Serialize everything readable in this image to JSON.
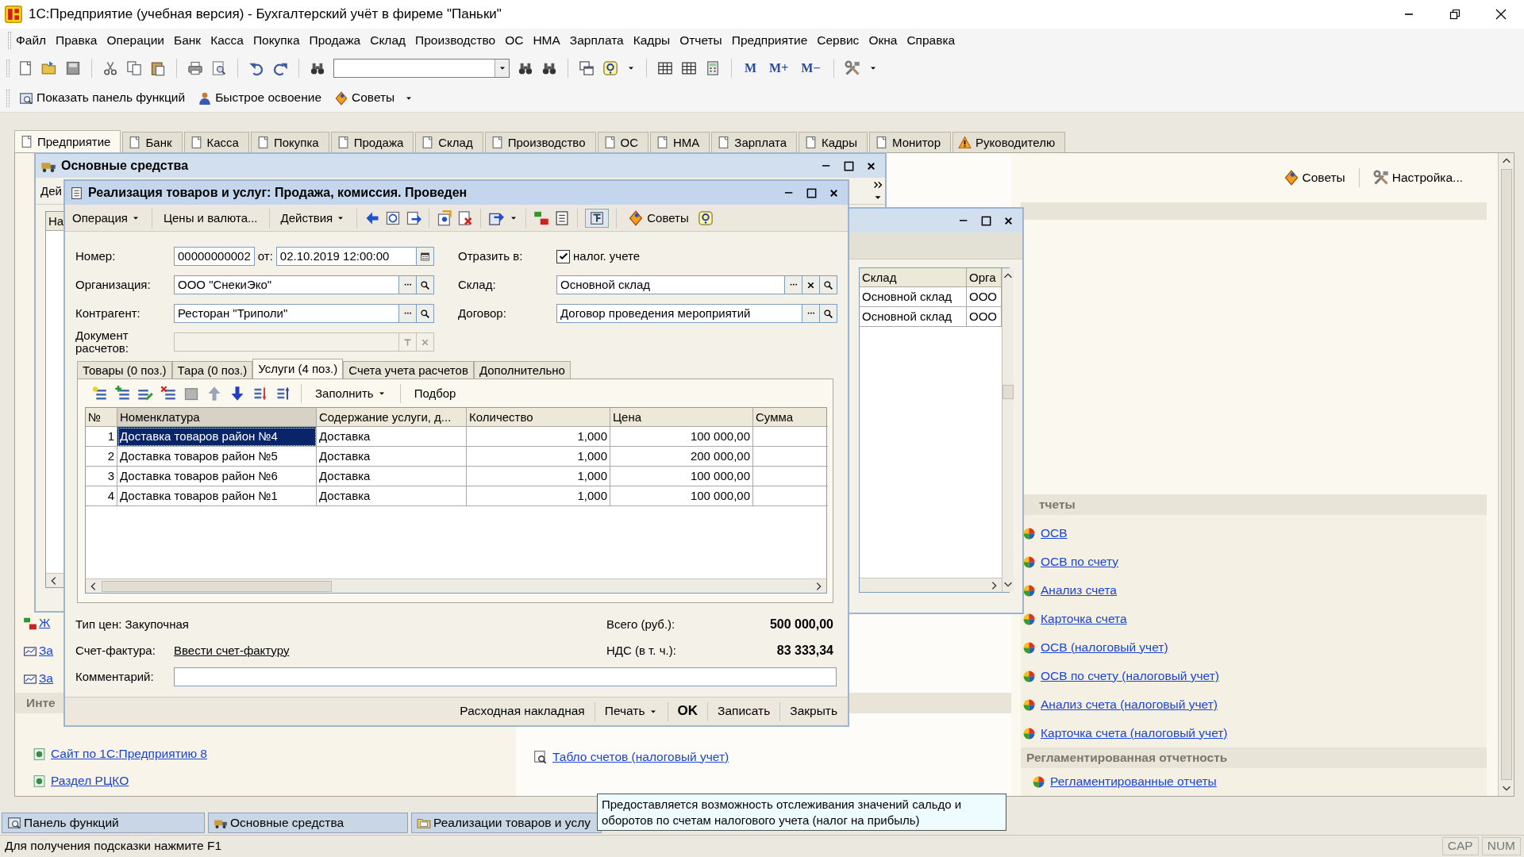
{
  "app_window": {
    "title": "1С:Предприятие (учебная версия) - Бухгалтерский учёт в фиреме \"Паньки\""
  },
  "menu": [
    "Файл",
    "Правка",
    "Операции",
    "Банк",
    "Касса",
    "Покупка",
    "Продажа",
    "Склад",
    "Производство",
    "ОС",
    "НМА",
    "Зарплата",
    "Кадры",
    "Отчеты",
    "Предприятие",
    "Сервис",
    "Окна",
    "Справка"
  ],
  "toolbar": {
    "memory_buttons": [
      "M",
      "M+",
      "M−"
    ]
  },
  "quick_bar": [
    "Показать панель функций",
    "Быстрое освоение",
    "Советы"
  ],
  "section_tabs": [
    {
      "label": "Предприятие",
      "selected": true
    },
    {
      "label": "Банк",
      "selected": false
    },
    {
      "label": "Касса",
      "selected": false
    },
    {
      "label": "Покупка",
      "selected": false
    },
    {
      "label": "Продажа",
      "selected": false
    },
    {
      "label": "Склад",
      "selected": false
    },
    {
      "label": "Производство",
      "selected": false
    },
    {
      "label": "ОС",
      "selected": false
    },
    {
      "label": "НМА",
      "selected": false
    },
    {
      "label": "Зарплата",
      "selected": false
    },
    {
      "label": "Кадры",
      "selected": false
    },
    {
      "label": "Монитор",
      "selected": false
    },
    {
      "label": "Руководителю",
      "selected": false
    }
  ],
  "function_panel": {
    "tools": [
      "Советы",
      "Настройка..."
    ],
    "partial_links": [
      "Ж",
      "За",
      "За"
    ],
    "left_section": {
      "title": "Инте",
      "links": [
        "Сайт по 1С:Предприятию 8",
        "Раздел РЦКО"
      ]
    },
    "middle_links": [
      "Табло счетов (налоговый учет)"
    ],
    "report_section": {
      "title": "тчеты",
      "links": [
        "ОСВ",
        "ОСВ по счету",
        "Анализ счета",
        "Карточка счета",
        "ОСВ (налоговый учет)",
        "ОСВ по счету (налоговый учет)",
        "Анализ счета (налоговый учет)",
        "Карточка счета (налоговый учет)"
      ]
    },
    "regulated_section": {
      "title": "Регламентированная отчетность",
      "links": [
        "Регламентированные отчеты"
      ]
    }
  },
  "fixed_assets_window": {
    "title": "Основные средства",
    "toolbar_label": "Дей",
    "column_1": "На"
  },
  "list_window": {
    "columns": [
      "Склад",
      "Орга"
    ],
    "rows": [
      [
        "Основной склад",
        "ООО"
      ],
      [
        "Основной склад",
        "ООО"
      ]
    ]
  },
  "document_window": {
    "title": "Реализация товаров и услуг: Продажа, комиссия. Проведен",
    "commands": [
      {
        "label": "Операция",
        "dropdown": true
      },
      {
        "label": "Цены и валюта...",
        "dropdown": false
      },
      {
        "label": "Действия",
        "dropdown": true
      }
    ],
    "tips_button": "Советы",
    "number": {
      "label": "Номер:",
      "value": "00000000002"
    },
    "date": {
      "label": "от:",
      "value": "02.10.2019 12:00:00"
    },
    "reflect": {
      "label": "Отразить в:",
      "checkbox_label": "налог. учете",
      "checked": true
    },
    "left_fields": [
      {
        "label": "Организация:",
        "value": "ООО \"СнекиЭко\"",
        "disabled": false
      },
      {
        "label": "Контрагент:",
        "value": "Ресторан \"Триполи\"",
        "disabled": false
      },
      {
        "label": "Документ расчетов:",
        "disabled": true
      }
    ],
    "right_fields": [
      {
        "label": "Склад:",
        "value": "Основной склад",
        "clearable": true
      },
      {
        "label": "Договор:",
        "value": "Договор проведения мероприятий",
        "clearable": false
      }
    ],
    "tabs": [
      {
        "label": "Товары (0 поз.)",
        "selected": false
      },
      {
        "label": "Тара (0 поз.)",
        "selected": false
      },
      {
        "label": "Услуги (4 поз.)",
        "selected": true
      },
      {
        "label": "Счета учета расчетов",
        "selected": false
      },
      {
        "label": "Дополнительно",
        "selected": false
      }
    ],
    "table_commands": [
      {
        "label": "Заполнить",
        "dropdown": true
      },
      {
        "label": "Подбор",
        "dropdown": false
      }
    ],
    "columns": [
      "№",
      "Номенклатура",
      "Содержание услуги, д...",
      "Количество",
      "Цена",
      "Сумма"
    ],
    "rows": [
      {
        "n": "1",
        "item": "Доставка товаров район №4",
        "content": "Доставка",
        "quantity": "1,000",
        "price": "100 000,00",
        "selected": true
      },
      {
        "n": "2",
        "item": "Доставка товаров район №5",
        "content": "Доставка",
        "quantity": "1,000",
        "price": "200 000,00",
        "selected": false
      },
      {
        "n": "3",
        "item": "Доставка товаров район №6",
        "content": "Доставка",
        "quantity": "1,000",
        "price": "100 000,00",
        "selected": false
      },
      {
        "n": "4",
        "item": "Доставка товаров район №1",
        "content": "Доставка",
        "quantity": "1,000",
        "price": "100 000,00",
        "selected": false
      }
    ],
    "price_type": "Тип цен: Закупочная",
    "total_label": "Всего (руб.):",
    "total": "500 000,00",
    "invoice_label": "Счет-фактура:",
    "invoice_link": "Ввести счет-фактуру",
    "vat_label": "НДС (в т. ч.):",
    "vat": "83 333,34",
    "comment_label": "Комментарий:",
    "buttons": [
      {
        "label": "Расходная накладная",
        "dropdown": false,
        "default": false
      },
      {
        "label": "Печать",
        "dropdown": true,
        "default": false
      },
      {
        "label": "OK",
        "dropdown": false,
        "default": true
      },
      {
        "label": "Записать",
        "dropdown": false,
        "default": false
      },
      {
        "label": "Закрыть",
        "dropdown": false,
        "default": false
      }
    ]
  },
  "open_windows": [
    "Панель функций",
    "Основные средства",
    "Реализации товаров и услу"
  ],
  "tooltip": "Предоставляется возможность отслеживания значений сальдо и оборотов по счетам налогового учета (налог на прибыль)",
  "status_bar": {
    "hint": "Для получения подсказки нажмите F1",
    "indicators": [
      "CAP",
      "NUM"
    ]
  }
}
